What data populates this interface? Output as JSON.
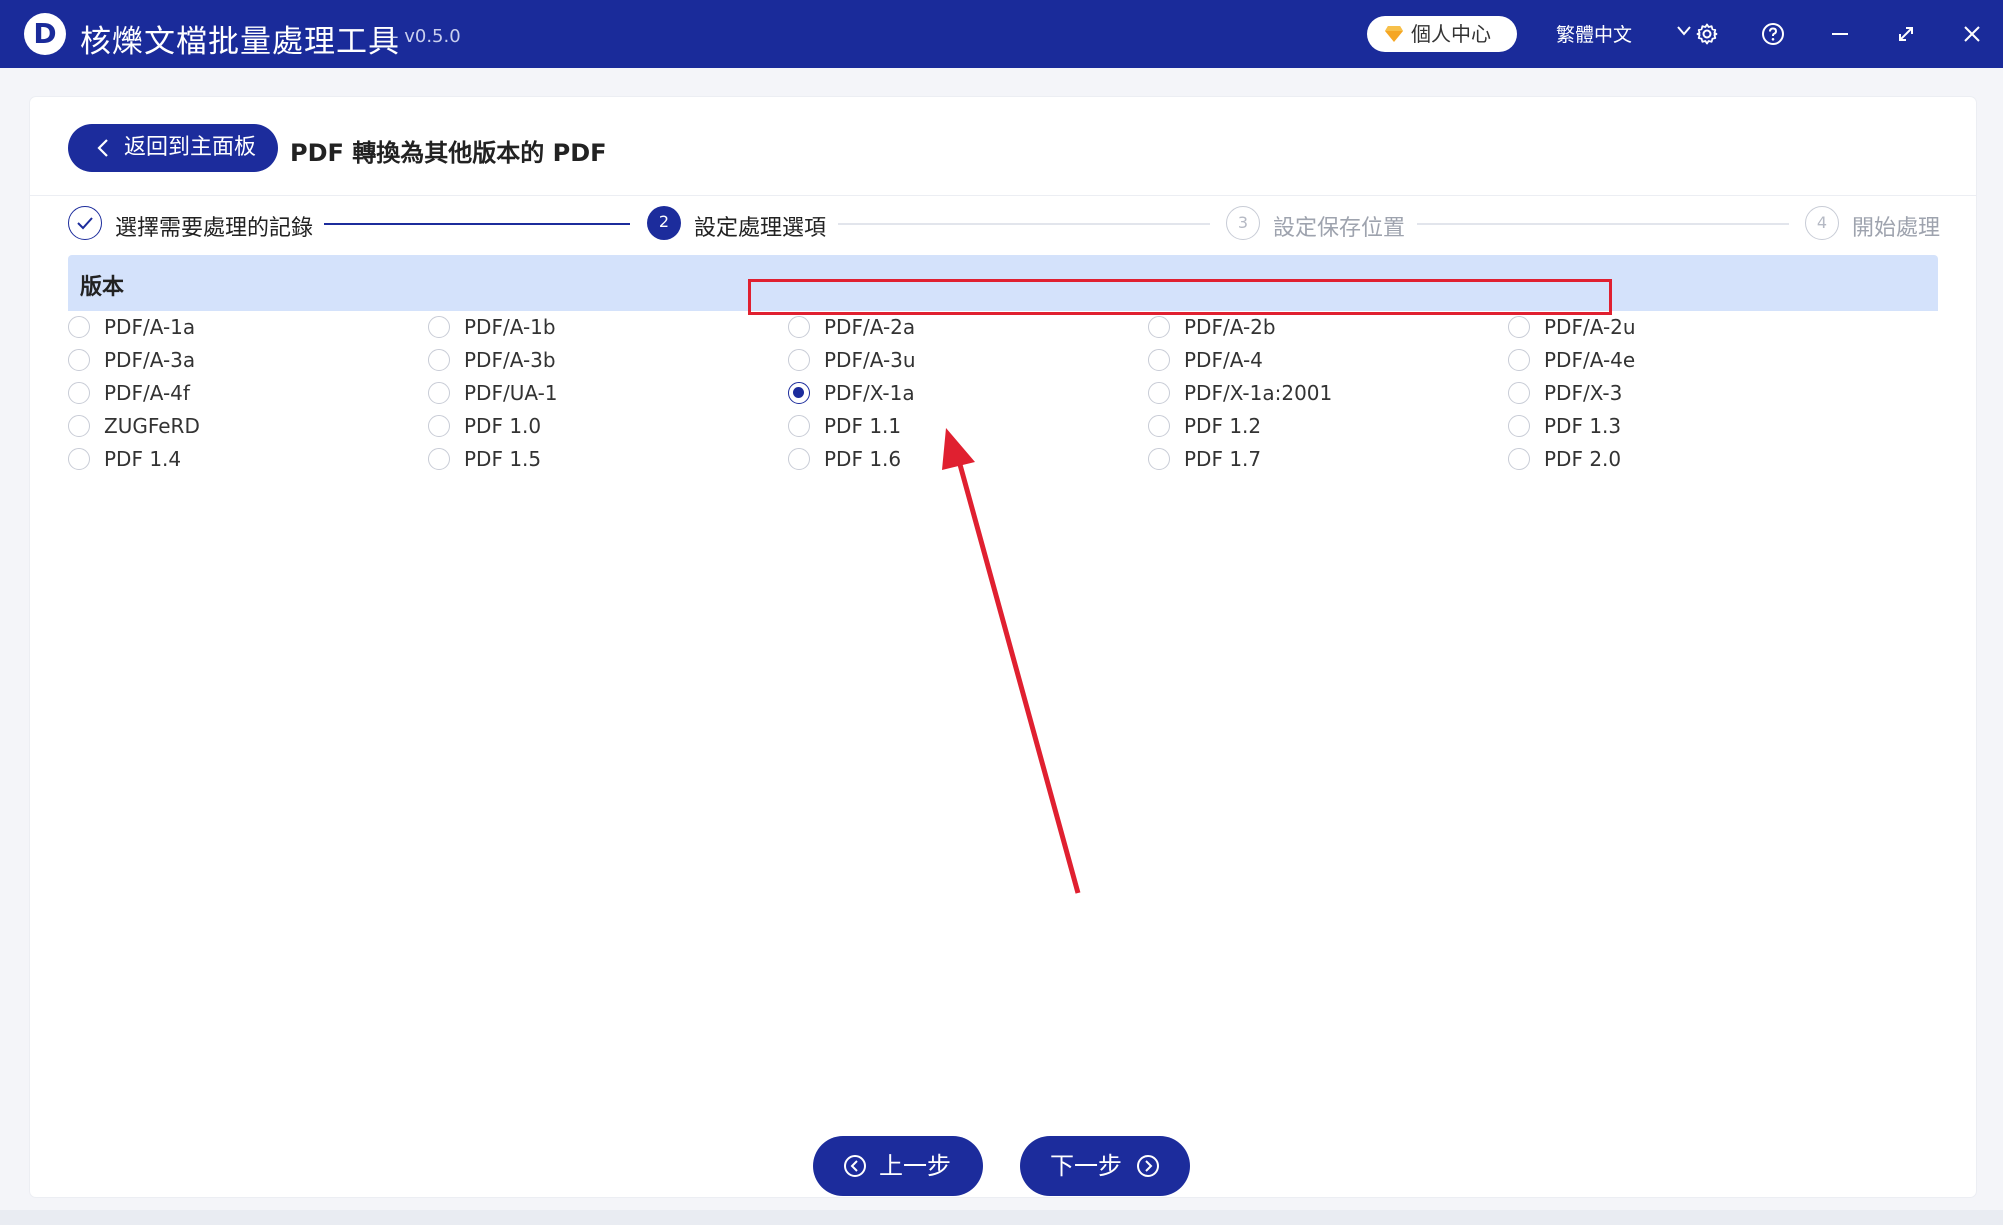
{
  "titlebar": {
    "logo_letter": "D",
    "app_title": "核爍文檔批量處理工具",
    "version": "- v0.5.0",
    "user_center": "個人中心",
    "language": "繁體中文"
  },
  "header": {
    "back_label": "返回到主面板",
    "page_title": "PDF 轉換為其他版本的 PDF"
  },
  "steps": [
    {
      "number": "",
      "label": "選擇需要處理的記錄",
      "state": "done"
    },
    {
      "number": "2",
      "label": "設定處理選項",
      "state": "active"
    },
    {
      "number": "3",
      "label": "設定保存位置",
      "state": "pending"
    },
    {
      "number": "4",
      "label": "開始處理",
      "state": "pending"
    }
  ],
  "section": {
    "title": "版本"
  },
  "options": [
    [
      "PDF/A-1a",
      "PDF/A-1b",
      "PDF/A-2a",
      "PDF/A-2b",
      "PDF/A-2u"
    ],
    [
      "PDF/A-3a",
      "PDF/A-3b",
      "PDF/A-3u",
      "PDF/A-4",
      "PDF/A-4e"
    ],
    [
      "PDF/A-4f",
      "PDF/UA-1",
      "PDF/X-1a",
      "PDF/X-1a:2001",
      "PDF/X-3"
    ],
    [
      "ZUGFeRD",
      "PDF 1.0",
      "PDF 1.1",
      "PDF 1.2",
      "PDF 1.3"
    ],
    [
      "PDF 1.4",
      "PDF 1.5",
      "PDF 1.6",
      "PDF 1.7",
      "PDF 2.0"
    ]
  ],
  "selected_option": "PDF/X-1a",
  "nav": {
    "prev_label": "上一步",
    "next_label": "下一步"
  },
  "colors": {
    "brand": "#1a2b9a",
    "button": "#1c2c9c",
    "section_bg": "#d4e2fb",
    "annotation": "#e02030",
    "pending": "#b5b9c4"
  }
}
